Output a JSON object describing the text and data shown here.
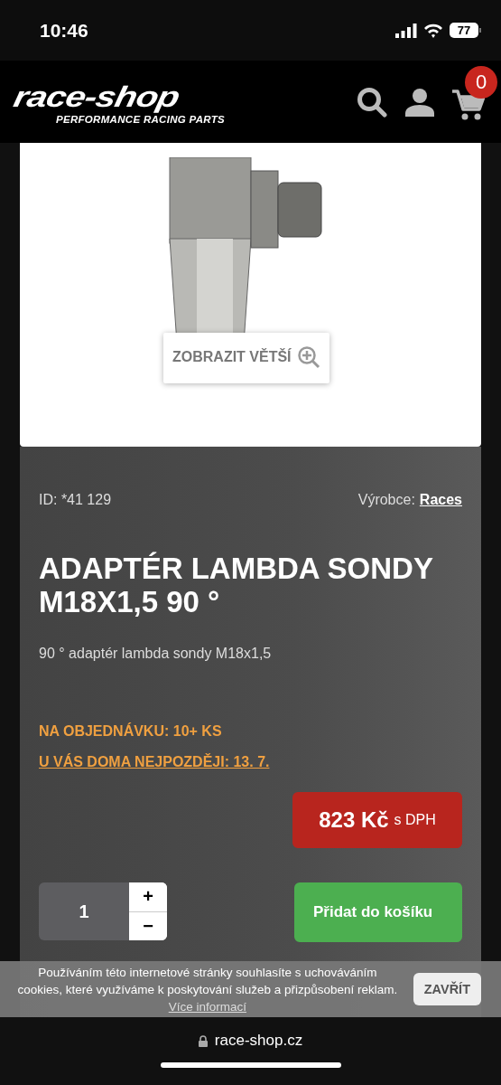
{
  "status_bar": {
    "time": "10:46",
    "battery": "77"
  },
  "header": {
    "logo": "race-shop",
    "tagline": "PERFORMANCE RACING PARTS",
    "cart_count": "0"
  },
  "product": {
    "zoom_label": "ZOBRAZIT VĚTŠÍ",
    "id": "ID: *41 129",
    "maker_label": "Výrobce:",
    "maker": "Races",
    "title": "ADAPTÉR LAMBDA SONDY M18X1,5 90 °",
    "description": "90 ° adaptér lambda sondy M18x1,5",
    "availability": "NA OBJEDNÁVKU: 10+ KS",
    "delivery": "U VÁS DOMA NEJPOZDĚJI: 13. 7.",
    "price": "823 Kč",
    "price_note": "s DPH",
    "quantity": "1",
    "plus": "+",
    "minus": "−",
    "add_button": "Přidat do košíku"
  },
  "cookie_banner": {
    "text": "Používáním této internetové stránky souhlasíte s uchováváním cookies, které využíváme k poskytování služeb a přizpůsobení reklam.",
    "link": "Více informací",
    "close": "ZAVŘÍT"
  },
  "browser": {
    "url": "race-shop.cz"
  }
}
